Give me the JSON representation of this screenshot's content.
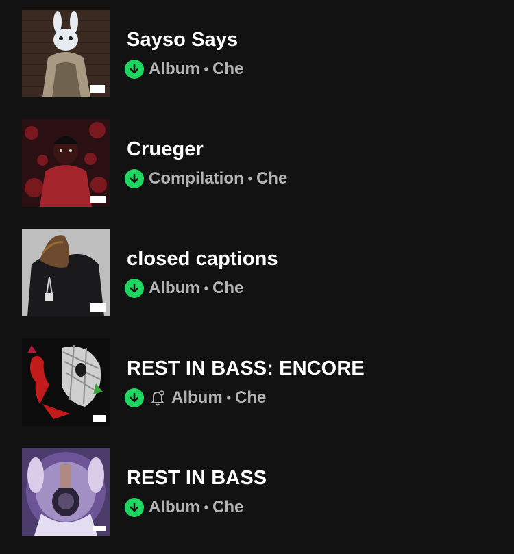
{
  "albums": [
    {
      "title": "Sayso Says",
      "type": "Album",
      "artist": "Che",
      "downloaded": true,
      "notify": false,
      "cover_icon": "rabbit-mask-cover"
    },
    {
      "title": "Crueger",
      "type": "Compilation",
      "artist": "Che",
      "downloaded": true,
      "notify": false,
      "cover_icon": "bloody-figure-cover"
    },
    {
      "title": "closed captions",
      "type": "Album",
      "artist": "Che",
      "downloaded": true,
      "notify": false,
      "cover_icon": "hooded-figure-cover"
    },
    {
      "title": "REST IN BASS: ENCORE",
      "type": "Album",
      "artist": "Che",
      "downloaded": true,
      "notify": true,
      "cover_icon": "skull-devil-cover"
    },
    {
      "title": "REST IN BASS",
      "type": "Album",
      "artist": "Che",
      "downloaded": true,
      "notify": false,
      "cover_icon": "psychedelic-cover"
    }
  ],
  "separator": "•",
  "colors": {
    "background": "#121212",
    "accent": "#1ed760",
    "title": "#ffffff",
    "subtitle": "#b3b3b3"
  }
}
